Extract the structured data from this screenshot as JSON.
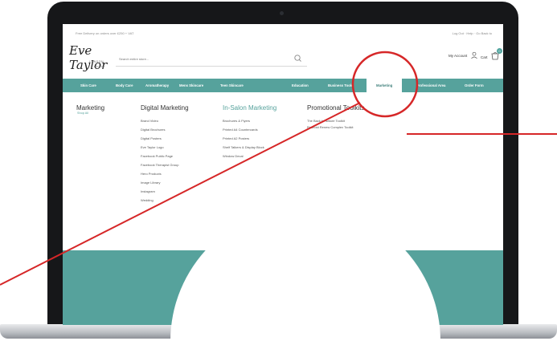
{
  "top_bar": {
    "left_text": "Free Delivery on orders over £250 + VAT",
    "right_text": "Log Out · Help · Go Back to"
  },
  "logo": {
    "script": "Eve Taylor",
    "subtitle": "LONDON",
    "est": "EST 1964"
  },
  "search": {
    "placeholder": "Search entire store..."
  },
  "header": {
    "account_label": "My Account",
    "cart_label": "Cart",
    "cart_count": "0"
  },
  "nav": {
    "items": [
      {
        "label": "Skin Care"
      },
      {
        "label": "Body Care"
      },
      {
        "label": "Aromatherapy"
      },
      {
        "label": "Mens Skincare"
      },
      {
        "label": "Teen Skincare"
      },
      {
        "label": "Education"
      },
      {
        "label": "Business Tools"
      },
      {
        "label": "Marketing"
      },
      {
        "label": "Professional Area"
      },
      {
        "label": "Order Form"
      }
    ],
    "active": "Marketing"
  },
  "menu": {
    "section_title": "Marketing",
    "shop_all": "Shop All",
    "columns": [
      {
        "title": "Digital Marketing",
        "items": [
          "Brand Video",
          "Digital Brochures",
          "Digital Posters",
          "Eve Taylor Logo",
          "Facebook Public Page",
          "Facebook Therapist Group",
          "Hero Products",
          "Image Library",
          "Instagram",
          "Wedding"
        ]
      },
      {
        "title": "In-Salon Marketing",
        "items": [
          "Brochures & Flyers",
          "Printed A4 Countercards",
          "Printed A2 Posters",
          "Shelf Talkers & Display Block",
          "Window Decal"
        ]
      },
      {
        "title": "Promotional Toolkits",
        "items": [
          "The Back to Nature Toolkit",
          "Retinoid Renew Complex Toolkit"
        ]
      }
    ]
  },
  "colors": {
    "accent": "#56a29c",
    "highlight": "#d62728"
  }
}
